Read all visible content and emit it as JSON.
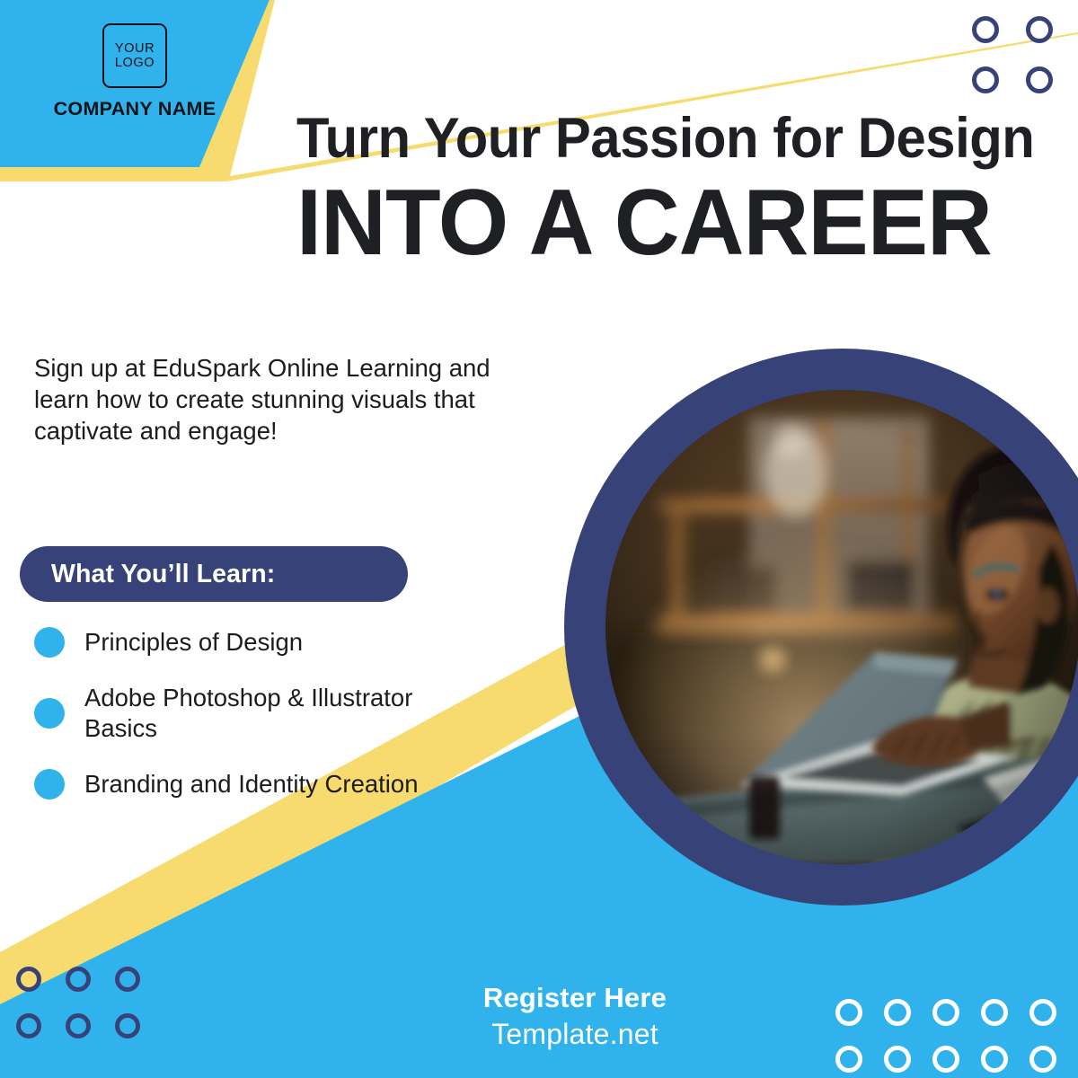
{
  "brand": {
    "logo_line_1": "YOUR",
    "logo_line_2": "LOGO",
    "company_name": "COMPANY NAME"
  },
  "headline": {
    "line_1": "Turn Your Passion for Design",
    "line_2": "INTO A CAREER"
  },
  "body": {
    "paragraph": "Sign up at EduSpark Online Learning and learn how to create stunning visuals that captivate and engage!"
  },
  "learn_section": {
    "pill_label": "What You’ll Learn:",
    "items": [
      {
        "label": "Principles of Design"
      },
      {
        "label": "Adobe Photoshop & Illustrator Basics"
      },
      {
        "label": "Branding and Identity Creation"
      }
    ]
  },
  "footer": {
    "cta": "Register Here",
    "url": "Template.net"
  },
  "photo": {
    "description": "Woman working on a laptop in a warmly lit room at night"
  },
  "colors": {
    "cyan": "#30B3EC",
    "navy": "#374378",
    "yellow": "#F7DB6E",
    "ink": "#1f2023",
    "white": "#ffffff"
  }
}
